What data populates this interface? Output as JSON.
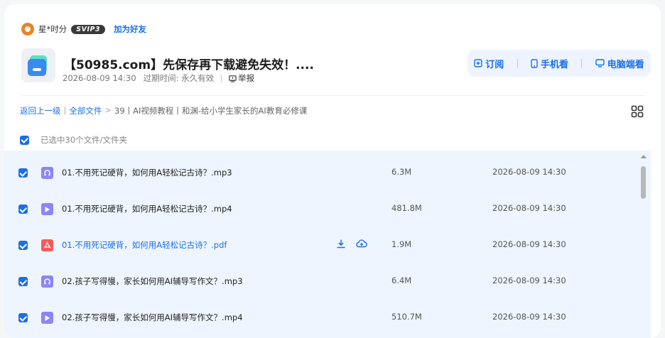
{
  "sharer": {
    "name": "星*时分",
    "vip_badge": "SVIP3",
    "add_friend": "加为好友"
  },
  "share": {
    "title": "【50985.com】先保存再下载避免失效！....",
    "date": "2026-08-09 14:30",
    "expire_label": "过期时间: 永久有效",
    "report": "举报"
  },
  "actions": {
    "subscribe": "订阅",
    "mobile": "手机看",
    "desktop": "电脑端看"
  },
  "breadcrumb": {
    "back": "返回上一级",
    "all": "全部文件",
    "sep": ">",
    "current": "39丨AI视频教程丨和渊-给小学生家长的AI教育必修课"
  },
  "selection": {
    "label": "已选中30个文件/文件夹"
  },
  "files": [
    {
      "name": "01.不用死记硬背，如何用A轻松记古诗？.mp3",
      "size": "6.3M",
      "date": "2026-08-09 14:30",
      "type": "mp3"
    },
    {
      "name": "01.不用死记硬背，如何用A轻松记古诗？.mp4",
      "size": "481.8M",
      "date": "2026-08-09 14:30",
      "type": "mp4"
    },
    {
      "name": "01.不用死记硬背，如何用A轻松记古诗？.pdf",
      "size": "1.9M",
      "date": "2026-08-09 14:30",
      "type": "pdf"
    },
    {
      "name": "02.孩子写得慢，家长如何用AI辅导写作文？.mp3",
      "size": "6.4M",
      "date": "2026-08-09 14:30",
      "type": "mp3"
    },
    {
      "name": "02.孩子写得慢，家长如何用AI辅导写作文？.mp4",
      "size": "510.7M",
      "date": "2026-08-09 14:30",
      "type": "mp4"
    }
  ],
  "colors": {
    "accent": "#1a6fe8",
    "row_bg": "#eef5fe",
    "pdf": "#f35a5a",
    "media": "#8b86f5"
  }
}
